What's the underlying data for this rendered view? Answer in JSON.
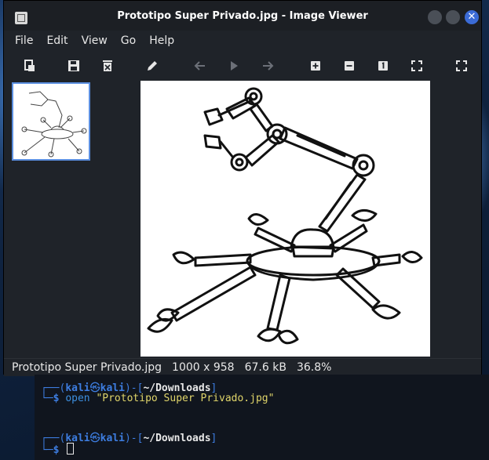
{
  "window": {
    "title": "Prototipo Super Privado.jpg - Image Viewer",
    "close_glyph": "✕"
  },
  "menu": [
    "File",
    "Edit",
    "View",
    "Go",
    "Help"
  ],
  "toolbar": {
    "icons": [
      "open-file-icon",
      "save-icon",
      "delete-icon",
      "edit-pencil-icon",
      "previous-arrow-icon",
      "play-icon",
      "next-arrow-icon",
      "zoom-in-icon",
      "zoom-out-icon",
      "zoom-1to1-icon",
      "fit-window-icon",
      "fullscreen-icon"
    ]
  },
  "status": {
    "filename": "Prototipo Super Privado.jpg",
    "dimensions": "1000 x 958",
    "size": "67.6 kB",
    "zoom": "36.8%"
  },
  "terminal": {
    "prompt1_user": "kali",
    "prompt1_at": "㉿",
    "prompt1_host": "kali",
    "prompt1_dir": "~/Downloads",
    "command_name": "open",
    "command_arg": "\"Prototipo Super Privado.jpg\"",
    "prompt2_user": "kali",
    "prompt2_at": "㉿",
    "prompt2_host": "kali",
    "prompt2_dir": "~/Downloads"
  },
  "colors": {
    "accent": "#3b6bd6",
    "window_bg": "#1f2329",
    "prompt_blue": "#3d7de0",
    "string_yellow": "#e0d56a"
  }
}
